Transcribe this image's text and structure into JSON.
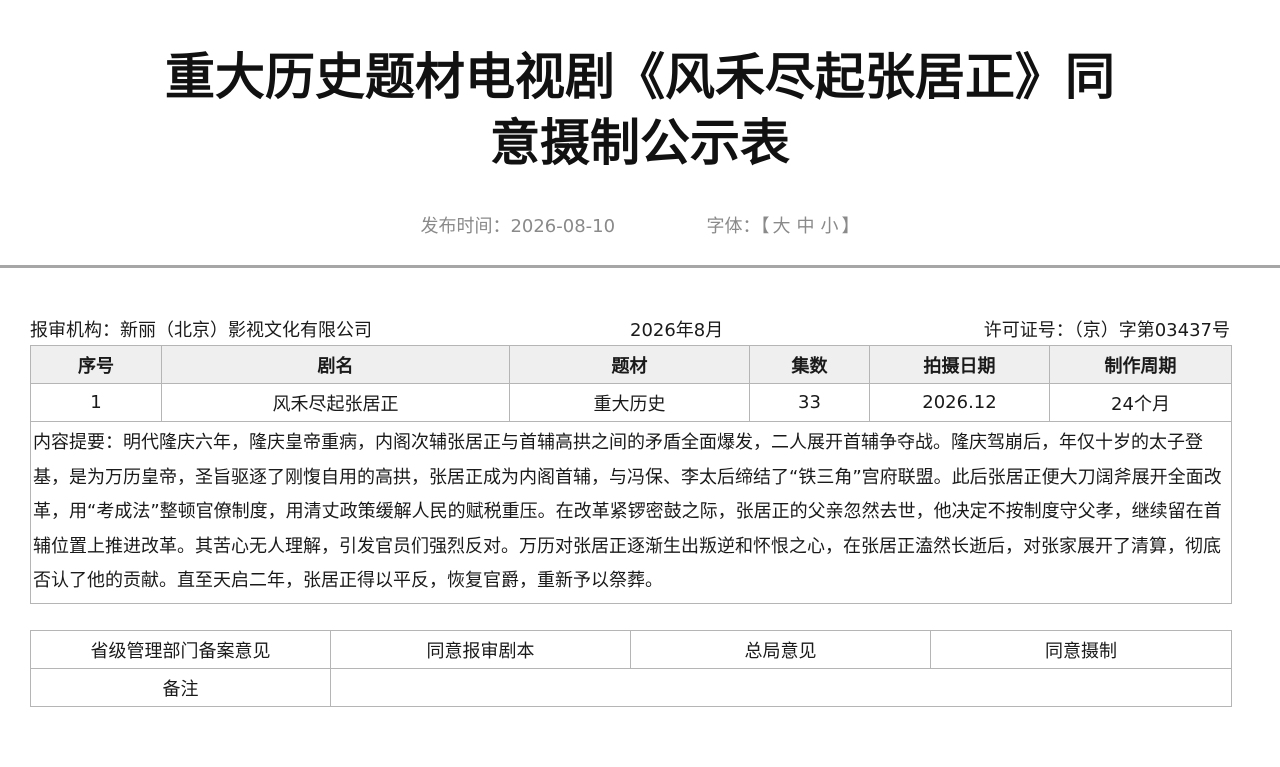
{
  "title": {
    "line1": "重大历史题材电视剧《风禾尽起张居正》同",
    "line2": "意摄制公示表"
  },
  "meta": {
    "publish_label": "发布时间：",
    "publish_date": "2026-08-10",
    "font_label": "字体：",
    "bracket_open": "【",
    "size_large": "大",
    "size_medium": "中",
    "size_small": "小",
    "bracket_close": "】"
  },
  "header": {
    "org_label": "报审机构：",
    "org_name": "新丽（北京）影视文化有限公司",
    "period": "2026年8月",
    "license_label": "许可证号：",
    "license_no": "（京）字第03437号"
  },
  "table": {
    "columns": [
      "序号",
      "剧名",
      "题材",
      "集数",
      "拍摄日期",
      "制作周期"
    ],
    "row": {
      "index": "1",
      "name": "风禾尽起张居正",
      "genre": "重大历史",
      "episodes": "33",
      "shoot_date": "2026.12",
      "cycle": "24个月"
    },
    "summary": "内容提要：明代隆庆六年，隆庆皇帝重病，内阁次辅张居正与首辅高拱之间的矛盾全面爆发，二人展开首辅争夺战。隆庆驾崩后，年仅十岁的太子登基，是为万历皇帝，圣旨驱逐了刚愎自用的高拱，张居正成为内阁首辅，与冯保、李太后缔结了“铁三角”宫府联盟。此后张居正便大刀阔斧展开全面改革，用“考成法”整顿官僚制度，用清丈政策缓解人民的赋税重压。在改革紧锣密鼓之际，张居正的父亲忽然去世，他决定不按制度守父孝，继续留在首辅位置上推进改革。其苦心无人理解，引发官员们强烈反对。万历对张居正逐渐生出叛逆和怀恨之心，在张居正溘然长逝后，对张家展开了清算，彻底否认了他的贡献。直至天启二年，张居正得以平反，恢复官爵，重新予以祭葬。"
  },
  "footer": {
    "provincial_label": "省级管理部门备案意见",
    "provincial_value": "同意报审剧本",
    "bureau_label": "总局意见",
    "bureau_value": "同意摄制",
    "remarks_label": "备注",
    "remarks_value": ""
  }
}
